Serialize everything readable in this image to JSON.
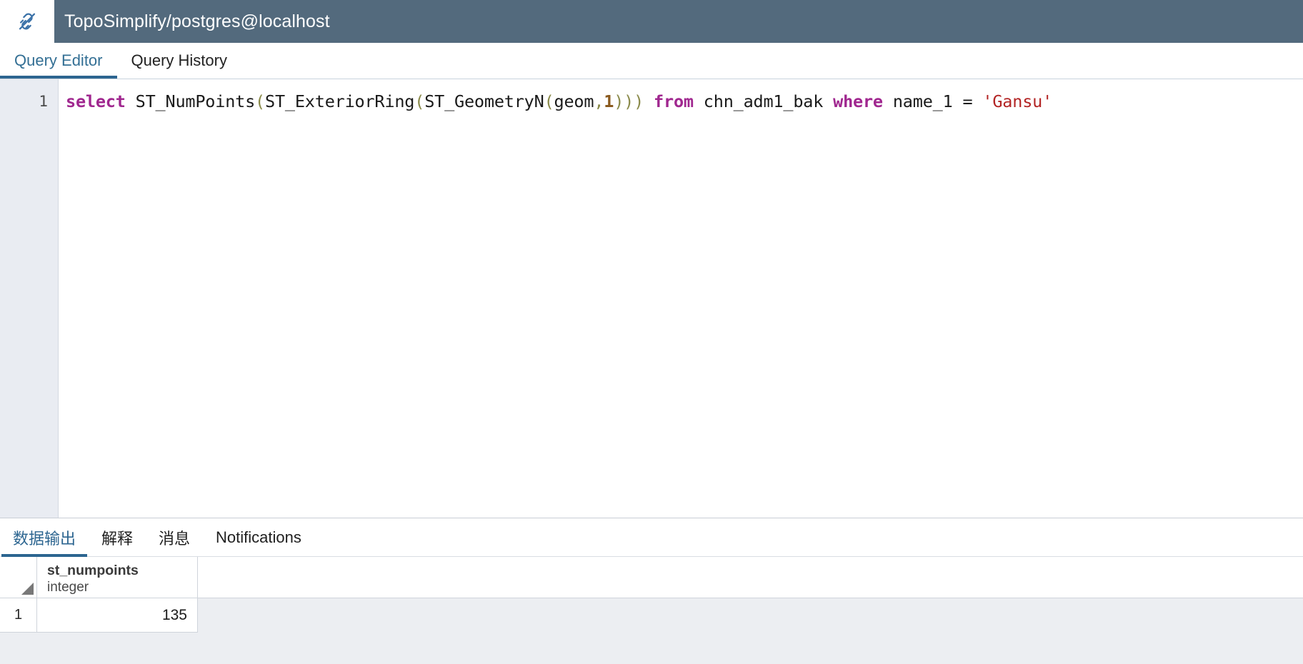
{
  "titlebar": {
    "icon": "plug-connection-icon",
    "title": "TopoSimplify/postgres@localhost",
    "background": "#536a7d"
  },
  "top_tabs": {
    "active_index": 0,
    "accent": "#2c6590",
    "items": [
      {
        "label": "Query Editor"
      },
      {
        "label": "Query History"
      }
    ]
  },
  "editor": {
    "line_number": "1",
    "gutter_background": "#e9ecf2",
    "query_plain": "select ST_NumPoints(ST_ExteriorRing(ST_GeometryN(geom,1))) from chn_adm1_bak where name_1 = 'Gansu'",
    "tokens": {
      "kw_select": "select",
      "sp1": " ",
      "fn_numpoints": "ST_NumPoints",
      "p_open1": "(",
      "fn_exteriorring": "ST_ExteriorRing",
      "p_open2": "(",
      "fn_geometryn": "ST_GeometryN",
      "p_open3": "(",
      "ident_geom": "geom",
      "comma": ",",
      "num_one": "1",
      "p_close": ")))",
      "sp2": " ",
      "kw_from": "from",
      "sp3": " ",
      "ident_table": "chn_adm1_bak",
      "sp4": " ",
      "kw_where": "where",
      "sp5": " ",
      "ident_col": "name_1",
      "sp6": " ",
      "op_eq": "=",
      "sp7": " ",
      "str_gansu": "'Gansu'"
    },
    "colors": {
      "keyword": "#a0278f",
      "paren": "#8a8a4a",
      "number": "#8a5a1e",
      "string": "#b32525",
      "identifier": "#1a1a1a"
    }
  },
  "bottom_tabs": {
    "active_index": 0,
    "accent": "#2c6590",
    "items": [
      {
        "label": "数据输出"
      },
      {
        "label": "解释"
      },
      {
        "label": "消息"
      },
      {
        "label": "Notifications"
      }
    ]
  },
  "result_grid": {
    "select_all_icon": "select-all-triangle-icon",
    "columns": [
      {
        "name": "st_numpoints",
        "type": "integer"
      }
    ],
    "rows": [
      {
        "row_number": "1",
        "st_numpoints": "135"
      }
    ]
  }
}
